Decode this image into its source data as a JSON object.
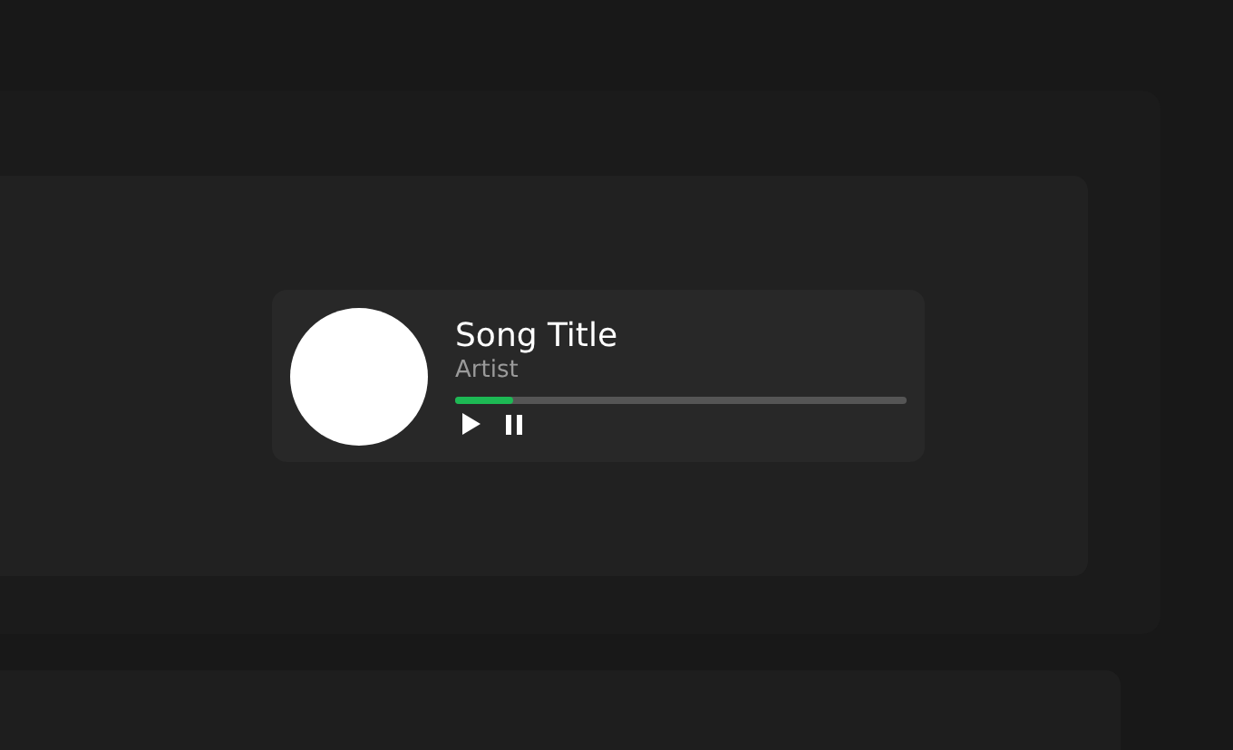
{
  "player": {
    "title": "Song Title",
    "artist": "Artist",
    "progress": {
      "level": 0.13
    },
    "controls": [
      {
        "kind": "play"
      },
      {
        "kind": "pause"
      }
    ]
  }
}
